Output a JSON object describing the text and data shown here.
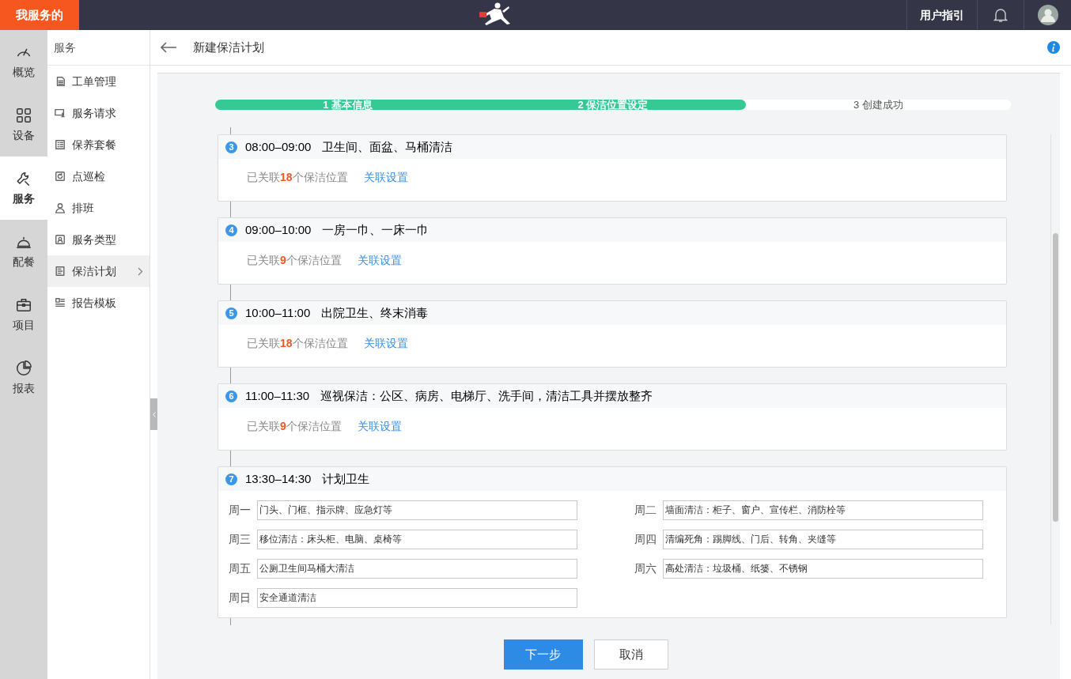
{
  "brand": "我服务的",
  "top_nav": {
    "guide": "用户指引"
  },
  "rail": [
    {
      "label": "概览",
      "selected": false
    },
    {
      "label": "设备",
      "selected": false
    },
    {
      "label": "服务",
      "selected": true
    },
    {
      "label": "配餐",
      "selected": false
    },
    {
      "label": "项目",
      "selected": false
    },
    {
      "label": "报表",
      "selected": false
    }
  ],
  "submenu": {
    "title": "服务",
    "items": [
      {
        "label": "工单管理",
        "selected": false
      },
      {
        "label": "服务请求",
        "selected": false
      },
      {
        "label": "保养套餐",
        "selected": false
      },
      {
        "label": "点巡检",
        "selected": false
      },
      {
        "label": "排班",
        "selected": false
      },
      {
        "label": "服务类型",
        "selected": false
      },
      {
        "label": "保洁计划",
        "selected": true
      },
      {
        "label": "报告模板",
        "selected": false
      }
    ]
  },
  "page": {
    "title": "新建保洁计划"
  },
  "steps": [
    {
      "label": "1 基本信息",
      "done": true
    },
    {
      "label": "2 保洁位置设定",
      "done": true
    },
    {
      "label": "3 创建成功",
      "done": false
    }
  ],
  "plans": [
    {
      "kind": "linked",
      "index": "3",
      "time": "08:00–09:00",
      "title": "卫生间、面盆、马桶清洁",
      "summary": "已关联**18**个保洁位置",
      "link": "关联设置"
    },
    {
      "kind": "linked",
      "index": "4",
      "time": "09:00–10:00",
      "title": "一房一巾、一床一巾",
      "summary": "已关联**9**个保洁位置",
      "link": "关联设置"
    },
    {
      "kind": "linked",
      "index": "5",
      "time": "10:00–11:00",
      "title": "出院卫生、终末消毒",
      "summary": "已关联**18**个保洁位置",
      "link": "关联设置"
    },
    {
      "kind": "linked",
      "index": "6",
      "time": "11:00–11:30",
      "title": "巡视保洁：公区、病房、电梯厅、洗手间，清洁工具并摆放整齐",
      "summary": "已关联**9**个保洁位置",
      "link": "关联设置"
    },
    {
      "kind": "weekly",
      "index": "7",
      "time": "13:30–14:30",
      "title": "计划卫生",
      "days": [
        {
          "day": "周一",
          "value": "门头、门框、指示牌、应急灯等"
        },
        {
          "day": "周二",
          "value": "墙面清洁：柜子、窗户、宣传栏、消防栓等"
        },
        {
          "day": "周三",
          "value": "移位清洁：床头柜、电脑、桌椅等"
        },
        {
          "day": "周四",
          "value": "清编死角：踢脚线、门后、转角、夹缝等"
        },
        {
          "day": "周五",
          "value": "公厕卫生间马桶大清洁"
        },
        {
          "day": "周六",
          "value": "高处清洁：垃圾桶、纸篓、不锈钢"
        },
        {
          "day": "周日",
          "value": "安全通道清洁"
        }
      ]
    }
  ],
  "buttons": [
    {
      "label": "下一步",
      "primary": true
    },
    {
      "label": "取消",
      "primary": false
    }
  ]
}
